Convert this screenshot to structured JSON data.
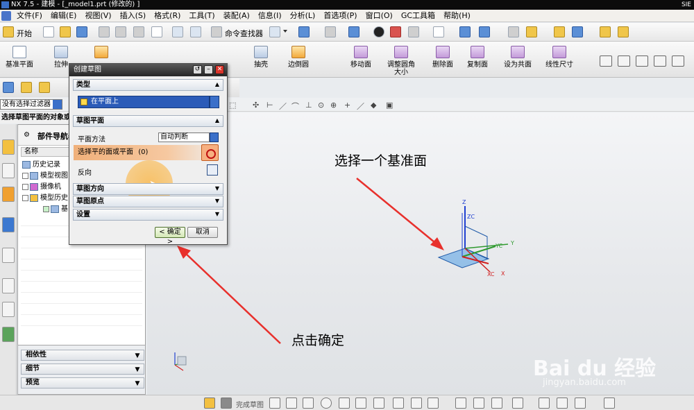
{
  "window": {
    "title": "NX 7.5 - 建模 - [_model1.prt (修改的) ]",
    "corner_logo": "SIE"
  },
  "menu": [
    "文件(F)",
    "编辑(E)",
    "视图(V)",
    "插入(S)",
    "格式(R)",
    "工具(T)",
    "装配(A)",
    "信息(I)",
    "分析(L)",
    "首选项(P)",
    "窗口(O)",
    "GC工具箱",
    "帮助(H)"
  ],
  "toolbar1": {
    "start": "开始",
    "command_finder": "命令查找器"
  },
  "toolbar2": [
    {
      "label": "基准平面"
    },
    {
      "label": "拉伸"
    },
    {
      "label": "抽壳"
    },
    {
      "label": "边倒圆"
    },
    {
      "label": "移动面"
    },
    {
      "label": "调整圆角",
      "label2": "大小"
    },
    {
      "label": "删除面"
    },
    {
      "label": "复制面"
    },
    {
      "label": "设为共面"
    },
    {
      "label": "线性尺寸"
    }
  ],
  "filter": {
    "label": "没有选择过滤器"
  },
  "status": "选择草图平面的对象或",
  "navigator": {
    "title": "部件导航器",
    "column": "名称",
    "items": [
      "历史记录",
      "模型视图",
      "摄像机",
      "模型历史",
      "基"
    ],
    "panels": [
      "相依性",
      "细节",
      "预览"
    ]
  },
  "dialog": {
    "title": "创建草图",
    "section_type": "类型",
    "type_value": "在平面上",
    "section_plane": "草图平面",
    "plane_method_label": "平面方法",
    "plane_method_value": "自动判断",
    "select_label": "选择平的面或平面",
    "select_count": "(0)",
    "reverse_label": "反向",
    "section_direction": "草图方向",
    "section_origin": "草图原点",
    "section_settings": "设置",
    "ok": "< 确定 >",
    "cancel": "取消"
  },
  "annotations": {
    "select_plane": "选择一个基准面",
    "click_ok": "点击确定"
  },
  "axes": {
    "x": "X",
    "y": "Y",
    "z": "Z",
    "xc": "XC",
    "yc": "YC",
    "zc": "ZC"
  },
  "bottom_toolbar": {
    "finish_sketch": "完成草图"
  },
  "watermark": {
    "brand": "Bai du 经验",
    "url": "jingyan.baidu.com"
  },
  "colors": {
    "accent": "#2b5bb8",
    "annotation_arrow": "#e8302c",
    "highlight": "#f9b950",
    "plane": "#7fb5e6"
  }
}
